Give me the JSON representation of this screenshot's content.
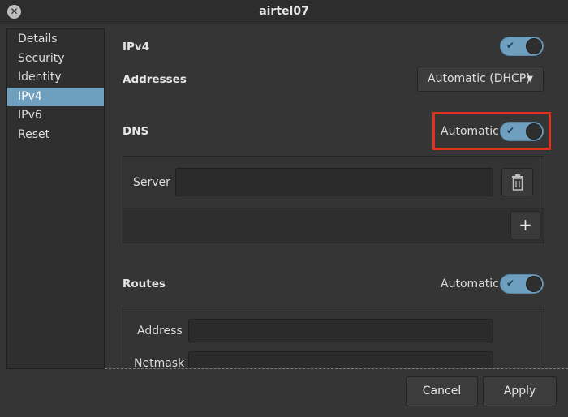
{
  "window": {
    "title": "airtel07",
    "close_icon": "close-icon"
  },
  "sidebar": {
    "items": [
      {
        "label": "Details"
      },
      {
        "label": "Security"
      },
      {
        "label": "Identity"
      },
      {
        "label": "IPv4",
        "selected": true
      },
      {
        "label": "IPv6"
      },
      {
        "label": "Reset"
      }
    ]
  },
  "ipv4": {
    "title": "IPv4",
    "enabled": true
  },
  "addresses": {
    "label": "Addresses",
    "selected": "Automatic (DHCP)"
  },
  "dns": {
    "label": "DNS",
    "automatic_label": "Automatic",
    "automatic": true,
    "server_label": "Server",
    "server_value": "",
    "delete_icon": "trash-icon",
    "add_label": "+"
  },
  "routes": {
    "label": "Routes",
    "automatic_label": "Automatic",
    "automatic": true,
    "address_label": "Address",
    "netmask_label": "Netmask",
    "address_value": "",
    "netmask_value": ""
  },
  "footer": {
    "cancel_label": "Cancel",
    "apply_label": "Apply"
  },
  "colors": {
    "accent": "#6e9fbf",
    "highlight_box": "#e0301e",
    "background": "#353535"
  }
}
